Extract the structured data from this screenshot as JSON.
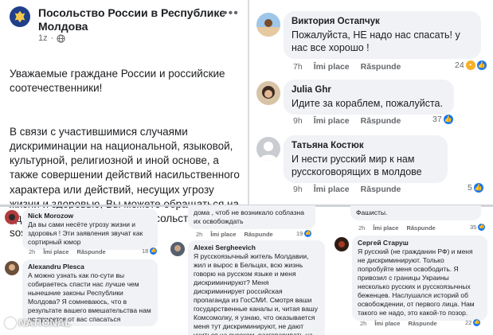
{
  "embassy_post": {
    "page_name": "Посольство России в Республике Молдова",
    "time": "1z",
    "paragraphs": [
      "Уважаемые граждане России и российские соотечественники!",
      "В связи с участившимися случаями дискриминации на национальной, языковой, культурной, религиозной и иной основе, а также совершении действий насильственного характера или действий, несущих угрозу жизни и здоровью, Вы можете обращаться на адрес электронной почты Посольства sos.moldova@mail.ru"
    ],
    "menu_icon": "more-dots-icon",
    "privacy_icon": "globe-icon"
  },
  "top_comments": [
    {
      "name": "Виктория Остапчук",
      "text": "Пожалуйста, НЕ надо нас спасать! у нас все хорошо !",
      "time": "7h",
      "like": "Îmi place",
      "reply": "Răspunde",
      "reactions": "24"
    },
    {
      "name": "Julia Ghr",
      "text": "Идите за кораблем, пожалуйста.",
      "time": "9h",
      "like": "Îmi place",
      "reply": "Răspunde",
      "reactions": "37"
    },
    {
      "name": "Татьяна Костюк",
      "text": "И нести русский мир к нам русскоговорящих в молдове",
      "time": "9h",
      "like": "Îmi place",
      "reply": "Răspunde",
      "reactions": "5"
    }
  ],
  "bottom_left": [
    {
      "name": "Nick Morozow",
      "text": "Да вы сами несёте угрозу жизни и здоровья ! Эти заявления звучат как сортирный юмор",
      "time": "2h",
      "like": "Îmi place",
      "reply": "Răspunde",
      "reactions": "18"
    },
    {
      "name": "Alexandru Plesca",
      "text": "А можно узнать как по-сути вы собираетесь спасти нас лучше чем нынешние законы Республики Молдова? Я сомневаюсь, что в результате вашего вмешательства нам не придется от вас спасаться",
      "time": "",
      "like": "",
      "reply": "",
      "reactions": ""
    }
  ],
  "bottom_middle": {
    "fragment_text": "дома , чтоб не возникало соблазна их освобождать",
    "fragment_time": "2h",
    "fragment_like": "Îmi place",
    "fragment_reply": "Răspunde",
    "fragment_reactions": "19",
    "name": "Alexei Sergheevich",
    "text": "Я русскоязычный житель Молдавии, жил и вырос в Бельцах, всю жизнь говорю на русском языке и меня дискриминируют? Меня дискриминирует российская пропаганда из ГосСМИ. Смотря ваши государственные каналы и, читая вашу Комсомолку, я узнаю, что оказывается меня тут дискриминируют, не дают учиться на русском, разговаривать на"
  },
  "bottom_right": {
    "fragment_text": "Фашисты.",
    "fragment_time": "2h",
    "fragment_like": "Îmi place",
    "fragment_reply": "Răspunde",
    "fragment_reactions": "35",
    "name": "Сергей Старуш",
    "text": "Я русский (не гражданин РФ) и меня не дискриминируют. Только попробуйте меня освободить. Я привозил с границы Украины несколько русских и русскоязычных беженцев. Наслушался историй об освобождении, от первого лица. Нам такого не надо, это какой-то позор.",
    "time": "2h",
    "like": "Îmi place",
    "reply": "Răspunde",
    "reactions": "22"
  },
  "watermark": "NATIONAL",
  "colors": {
    "like_blue": "#1877f2",
    "bubble_bg": "#f0f2f5",
    "meta_gray": "#65676b"
  }
}
